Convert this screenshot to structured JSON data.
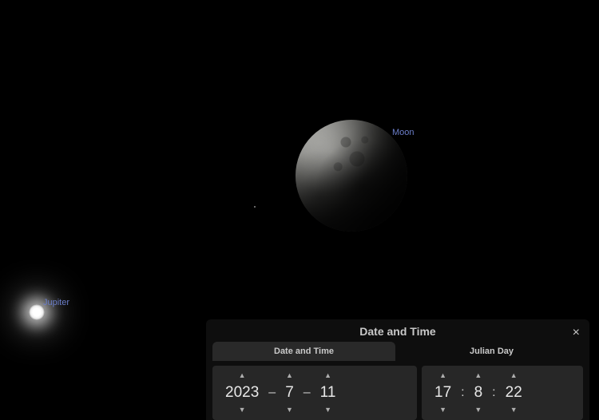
{
  "labels": {
    "moon": "Moon",
    "jupiter": "Jupiter"
  },
  "panel": {
    "title": "Date and Time",
    "close": "×",
    "tabs": {
      "datetime": "Date and Time",
      "julian": "Julian Day"
    },
    "date": {
      "year": "2023",
      "month": "7",
      "day": "11",
      "sep": "–"
    },
    "time": {
      "hour": "17",
      "minute": "8",
      "second": "22",
      "sep": ":"
    },
    "arrow_up": "▲",
    "arrow_down": "▼"
  }
}
